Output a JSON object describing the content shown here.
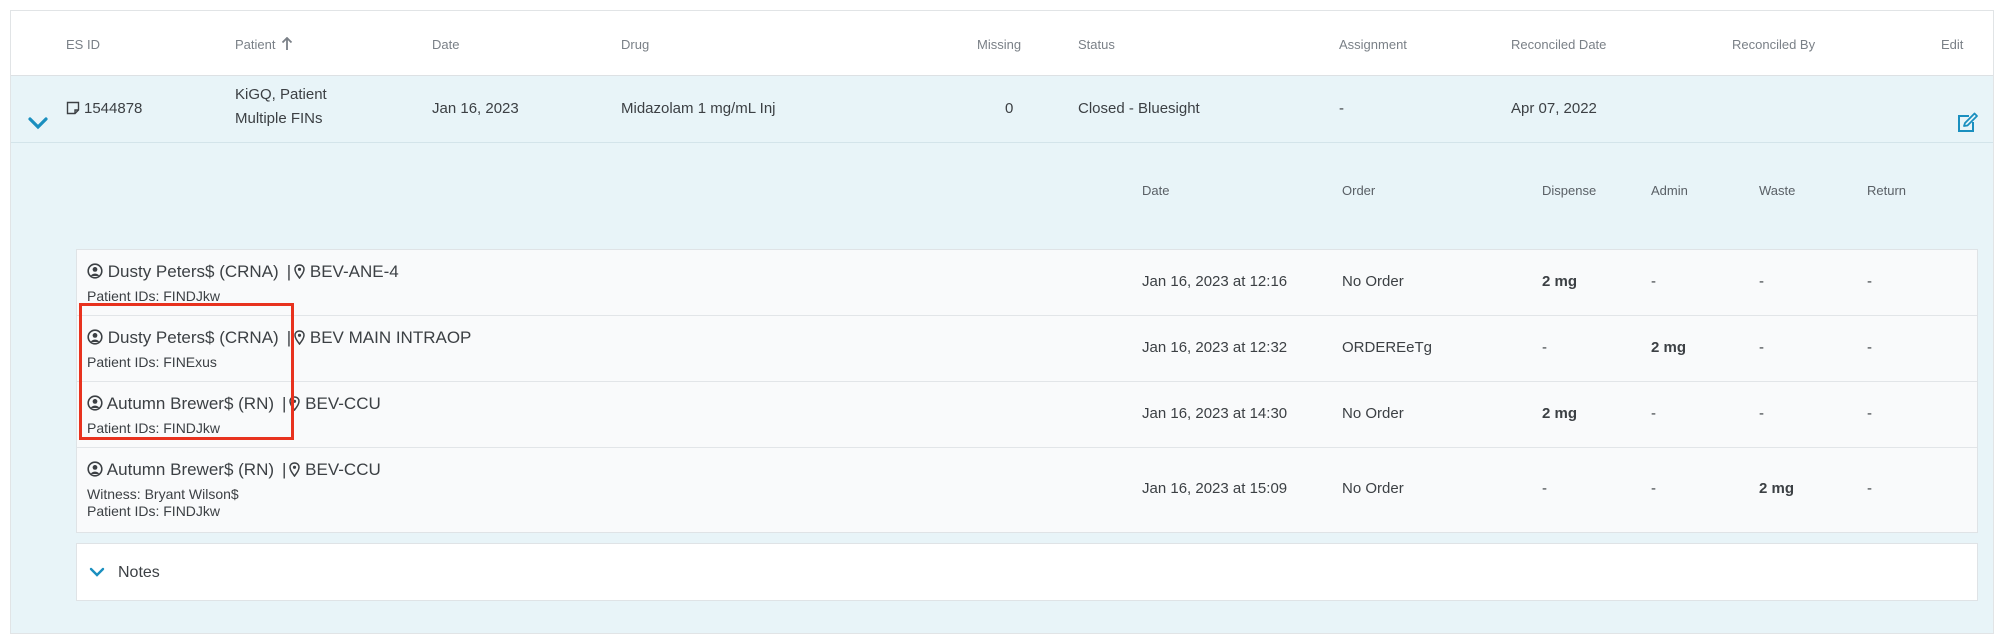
{
  "colors": {
    "accent": "#1a8fbf",
    "row_bg": "#e8f4f8",
    "highlight": "#e8321e"
  },
  "header": {
    "es_id": "ES ID",
    "patient": "Patient",
    "date": "Date",
    "drug": "Drug",
    "missing": "Missing",
    "status": "Status",
    "assignment": "Assignment",
    "reconciled_date": "Reconciled Date",
    "reconciled_by": "Reconciled By",
    "edit": "Edit"
  },
  "icons": {
    "sort": "arrow-up-icon",
    "expand": "chevron-down-icon",
    "doc": "document-icon",
    "edit": "edit-icon",
    "user": "user-circle-icon",
    "location": "map-pin-icon"
  },
  "record": {
    "es_id": "1544878",
    "patient_line1": "KiGQ, Patient",
    "patient_line2": "Multiple FINs",
    "date": "Jan 16, 2023",
    "drug": "Midazolam 1 mg/mL Inj",
    "missing": "0",
    "status": "Closed - Bluesight",
    "assignment": "-",
    "reconciled_date": "Apr 07, 2022",
    "reconciled_by": ""
  },
  "detail_header": {
    "date": "Date",
    "order": "Order",
    "dispense": "Dispense",
    "admin": "Admin",
    "waste": "Waste",
    "return": "Return"
  },
  "transactions": [
    {
      "user": "Dusty Peters$ (CRNA)",
      "location": "BEV-ANE-4",
      "witness": "",
      "patient_ids": "Patient IDs: FINDJkw",
      "date": "Jan 16, 2023 at 12:16",
      "order": "No Order",
      "dispense": "2 mg",
      "admin": "-",
      "waste": "-",
      "return": "-"
    },
    {
      "user": "Dusty Peters$ (CRNA)",
      "location": "BEV MAIN INTRAOP",
      "witness": "",
      "patient_ids": "Patient IDs: FINExus",
      "date": "Jan 16, 2023 at 12:32",
      "order": "ORDEREeTg",
      "dispense": "-",
      "admin": "2 mg",
      "waste": "-",
      "return": "-"
    },
    {
      "user": "Autumn Brewer$ (RN)",
      "location": "BEV-CCU",
      "witness": "",
      "patient_ids": "Patient IDs: FINDJkw",
      "date": "Jan 16, 2023 at 14:30",
      "order": "No Order",
      "dispense": "2 mg",
      "admin": "-",
      "waste": "-",
      "return": "-"
    },
    {
      "user": "Autumn Brewer$ (RN)",
      "location": "BEV-CCU",
      "witness": "Witness: Bryant Wilson$",
      "patient_ids": "Patient IDs: FINDJkw",
      "date": "Jan 16, 2023 at 15:09",
      "order": "No Order",
      "dispense": "-",
      "admin": "-",
      "waste": "2 mg",
      "return": "-"
    }
  ],
  "notes": {
    "label": "Notes"
  }
}
